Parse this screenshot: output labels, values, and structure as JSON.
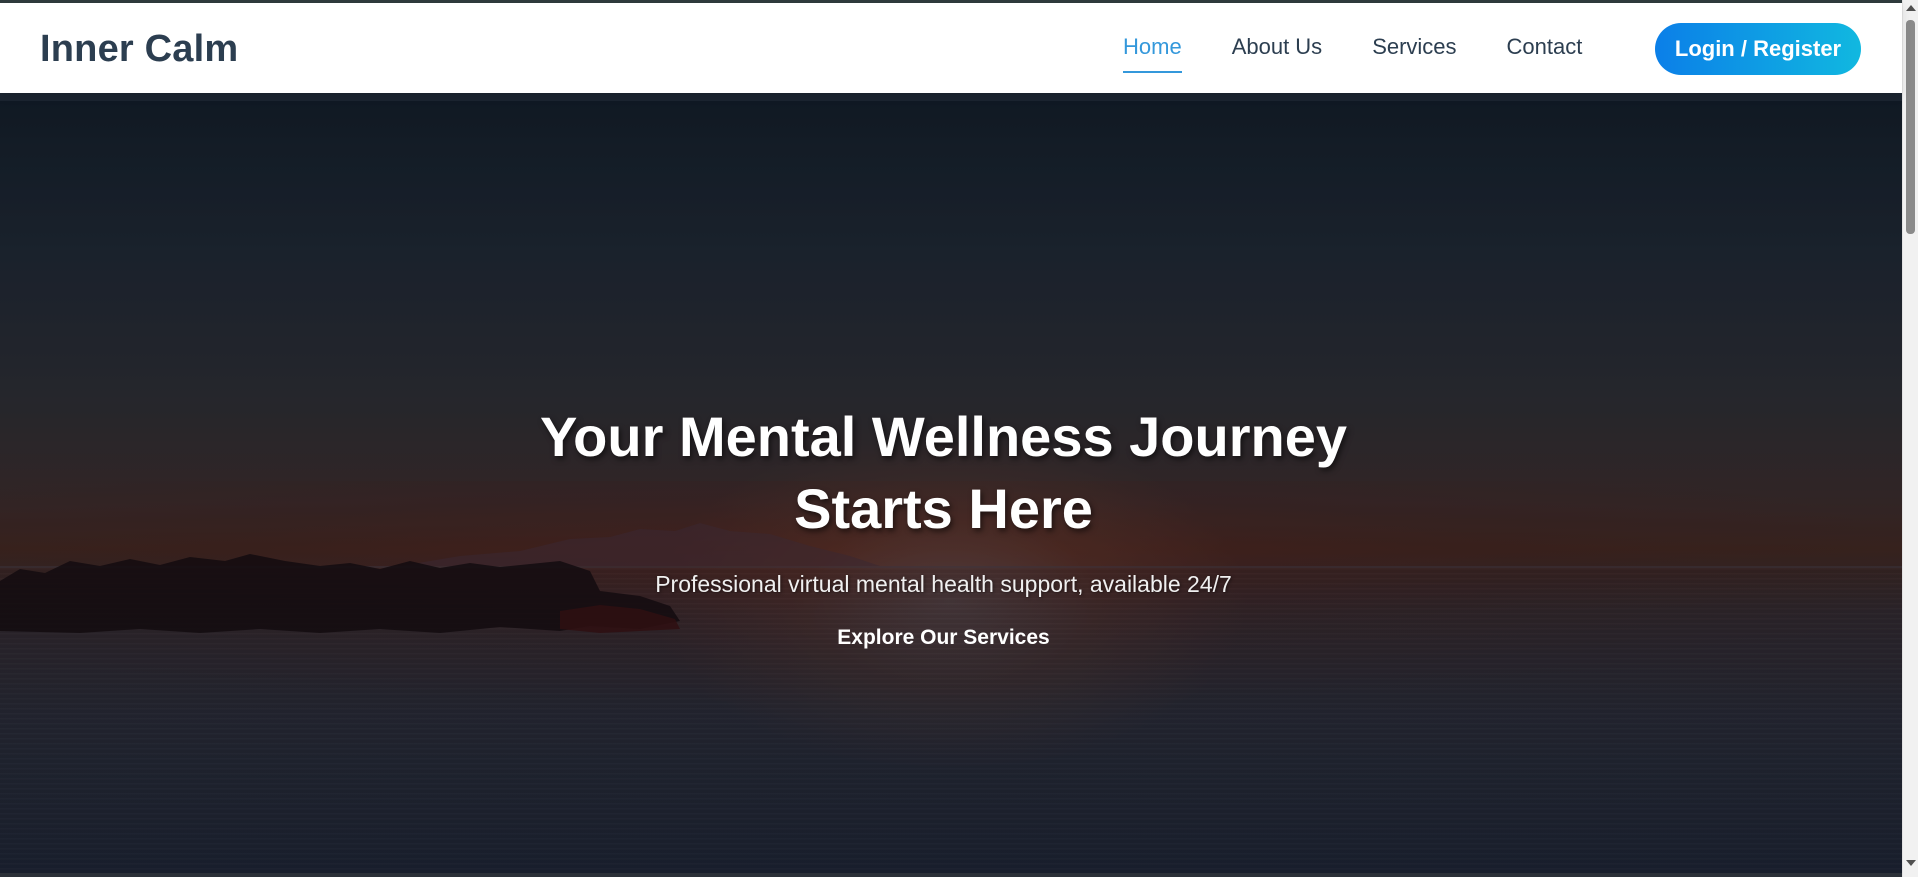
{
  "header": {
    "logo": "Inner Calm",
    "nav": [
      {
        "label": "Home",
        "active": true
      },
      {
        "label": "About Us",
        "active": false
      },
      {
        "label": "Services",
        "active": false
      },
      {
        "label": "Contact",
        "active": false
      }
    ],
    "login_label": "Login / Register"
  },
  "hero": {
    "title_line1": "Your Mental Wellness Journey",
    "title_line2": "Starts Here",
    "subtitle": "Professional virtual mental health support, available 24/7",
    "cta_label": "Explore Our Services"
  },
  "colors": {
    "accent": "#3498db",
    "text_dark": "#2c3e50",
    "button_gradient_start": "#0b7fe8",
    "button_gradient_end": "#11b8e0"
  }
}
